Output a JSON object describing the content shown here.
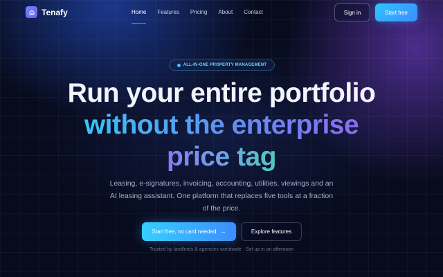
{
  "brand": {
    "name": "Tenafy",
    "icon": "house-icon"
  },
  "nav": {
    "links": [
      {
        "label": "Home",
        "active": true
      },
      {
        "label": "Features",
        "active": false
      },
      {
        "label": "Pricing",
        "active": false
      },
      {
        "label": "About",
        "active": false
      },
      {
        "label": "Contact",
        "active": false
      }
    ],
    "signin_label": "Sign in",
    "start_label": "Start free"
  },
  "hero": {
    "badge": "ALL-IN-ONE PROPERTY MANAGEMENT",
    "headline_line1": "Run your entire portfolio",
    "headline_line2": "without the enterprise",
    "headline_line3": "price tag",
    "subtitle": "Leasing, e-signatures, invoicing, accounting, utilities, viewings and an AI leasing assistant. One platform that replaces five tools at a fraction of the price.",
    "primary_cta": "Start free, no card needed",
    "primary_cta_arrow": "→",
    "secondary_cta": "Explore features",
    "trust_line": "Trusted by landlords & agencies worldwide · Set up in an afternoon"
  },
  "colors": {
    "background": "#070b1d",
    "accent": "#3d8dff",
    "accent_cyan": "#36cfff",
    "gradient_purple": "#8a6cf0",
    "gradient_teal": "#52c9b8"
  }
}
